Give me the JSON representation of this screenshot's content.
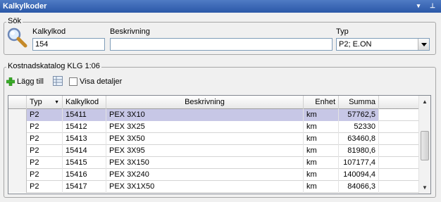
{
  "window": {
    "title": "Kalkylkoder",
    "dropdown_glyph": "▾",
    "pin_glyph": "⊥"
  },
  "search": {
    "group_title": "Sök",
    "code_label": "Kalkylkod",
    "code_value": "154",
    "desc_label": "Beskrivning",
    "desc_value": "",
    "type_label": "Typ",
    "type_value": "P2; E.ON"
  },
  "catalog": {
    "group_title": "Kostnadskatalog KLG 1:06",
    "add_label": "Lägg till",
    "details_label": "Visa detaljer",
    "details_checked": false
  },
  "table": {
    "columns": [
      "Typ",
      "Kalkylkod",
      "Beskrivning",
      "Enhet",
      "Summa"
    ],
    "sort_glyph": "▼",
    "rows": [
      {
        "typ": "P2",
        "kod": "15411",
        "beskrivning": "PEX 3X10",
        "enhet": "km",
        "summa": "57762,5",
        "selected": true
      },
      {
        "typ": "P2",
        "kod": "15412",
        "beskrivning": "PEX 3X25",
        "enhet": "km",
        "summa": "52330"
      },
      {
        "typ": "P2",
        "kod": "15413",
        "beskrivning": "PEX 3X50",
        "enhet": "km",
        "summa": "63460,8"
      },
      {
        "typ": "P2",
        "kod": "15414",
        "beskrivning": "PEX 3X95",
        "enhet": "km",
        "summa": "81980,6"
      },
      {
        "typ": "P2",
        "kod": "15415",
        "beskrivning": "PEX 3X150",
        "enhet": "km",
        "summa": "107177,4"
      },
      {
        "typ": "P2",
        "kod": "15416",
        "beskrivning": "PEX 3X240",
        "enhet": "km",
        "summa": "140094,4"
      },
      {
        "typ": "P2",
        "kod": "15417",
        "beskrivning": "PEX 3X1X50",
        "enhet": "km",
        "summa": "84066,3"
      }
    ]
  },
  "colors": {
    "title_bar": "#3a68b6",
    "selected_row": "#c7c7e6",
    "add_icon": "#3cae2a"
  }
}
